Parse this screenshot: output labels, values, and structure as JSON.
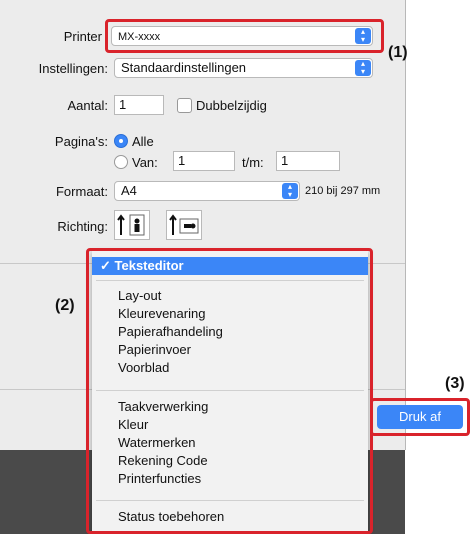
{
  "printer": {
    "label": "Printer",
    "value": "MX-xxxx"
  },
  "settings": {
    "label": "Instellingen:",
    "value": "Standaardinstellingen"
  },
  "copies": {
    "label": "Aantal:",
    "value": "1",
    "duplex_label": "Dubbelzijdig"
  },
  "pages": {
    "label": "Pagina's:",
    "all": "Alle",
    "from_label": "Van:",
    "from_value": "1",
    "to_label": "t/m:",
    "to_value": "1"
  },
  "format": {
    "label": "Formaat:",
    "value": "A4",
    "size_text": "210 bij 297 mm"
  },
  "orientation": {
    "label": "Richting:"
  },
  "menu": {
    "selected": "✓ Teksteditor",
    "group1": [
      "Lay-out",
      "Kleurevenaring",
      "Papierafhandeling",
      "Papierinvoer",
      "Voorblad"
    ],
    "group2": [
      "Taakverwerking",
      "Kleur",
      "Watermerken",
      "Rekening Code",
      "Printerfuncties"
    ],
    "group3": [
      "Status toebehoren"
    ]
  },
  "print_button": "Druk af",
  "callouts": {
    "c1": "(1)",
    "c2": "(2)",
    "c3": "(3)"
  },
  "colors": {
    "accent": "#3b86f7",
    "callout_border": "#d9232b"
  }
}
